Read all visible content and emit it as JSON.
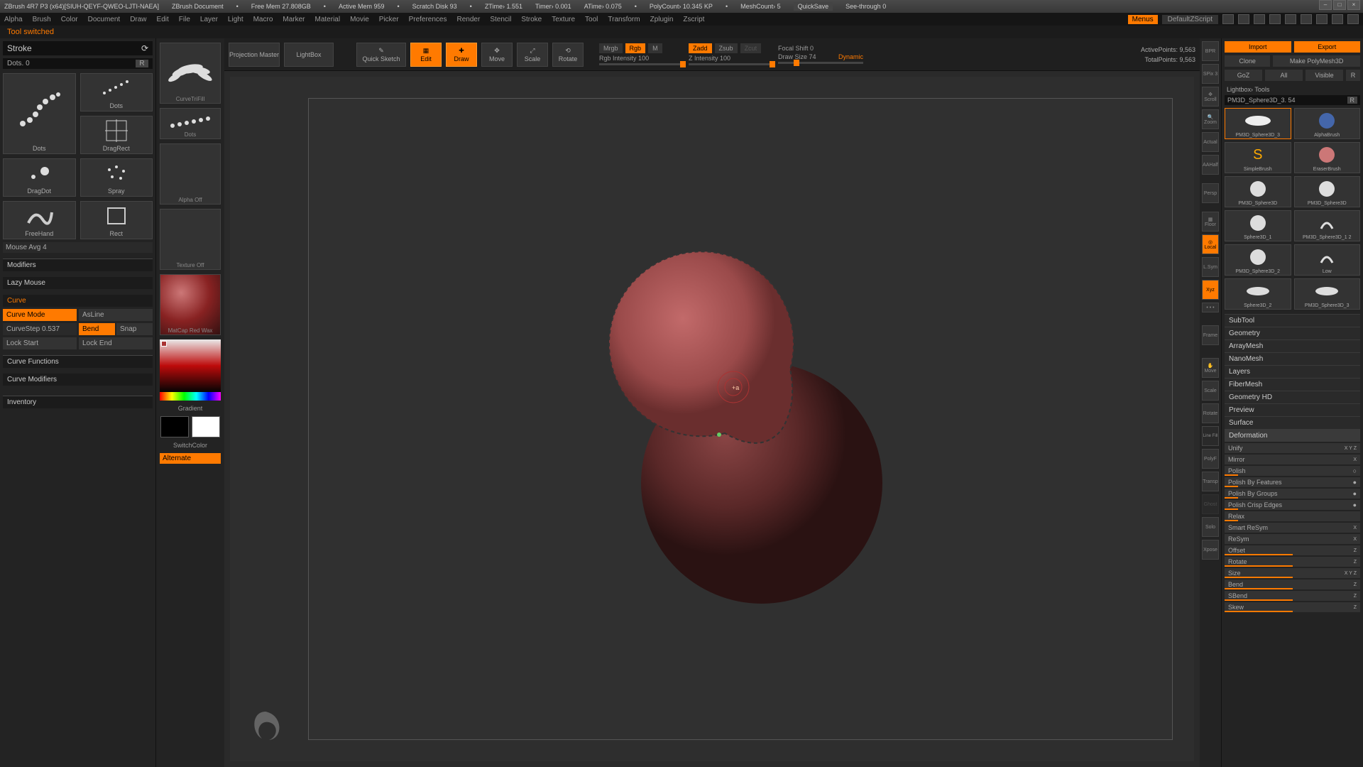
{
  "titlebar": {
    "app": "ZBrush 4R7 P3 (x64)[SIUH-QEYF-QWEO-LJTI-NAEA]",
    "doc": "ZBrush Document",
    "mem": "Free Mem 27.808GB",
    "actmem": "Active Mem 959",
    "scratch": "Scratch Disk 93",
    "ztime": "ZTime› 1.551",
    "timer": "Timer› 0.001",
    "atime": "ATime› 0.075",
    "poly": "PolyCount› 10.345 KP",
    "mesh": "MeshCount› 5",
    "quicksave": "QuickSave",
    "seethrough": "See-through 0"
  },
  "menubar": {
    "items": [
      "Alpha",
      "Brush",
      "Color",
      "Document",
      "Draw",
      "Edit",
      "File",
      "Layer",
      "Light",
      "Macro",
      "Marker",
      "Material",
      "Movie",
      "Picker",
      "Preferences",
      "Render",
      "Stencil",
      "Stroke",
      "Texture",
      "Tool",
      "Transform",
      "Zplugin",
      "Zscript"
    ],
    "menus": "Menus",
    "script": "DefaultZScript"
  },
  "status": "Tool switched",
  "stroke": {
    "title": "Stroke",
    "dots_label": "Dots. 0",
    "r": "R",
    "cells": [
      "",
      "Dots",
      "DragRect",
      "DragDot",
      "Spray",
      "FreeHand",
      "Rect"
    ],
    "mouse_avg": "Mouse Avg 4",
    "sections": {
      "modifiers": "Modifiers",
      "lazy": "Lazy Mouse",
      "curve": "Curve",
      "curvefn": "Curve Functions",
      "curvemod": "Curve Modifiers",
      "inventory": "Inventory"
    },
    "curveopts": {
      "mode": "Curve Mode",
      "asline": "AsLine",
      "step": "CurveStep 0.537",
      "bend": "Bend",
      "snap": "Snap",
      "lockstart": "Lock Start",
      "lockend": "Lock End"
    }
  },
  "col2": {
    "brush": "CurveTriFill",
    "dots": "Dots",
    "alpha": "Alpha Off",
    "texture": "Texture Off",
    "material": "MatCap Red Wax",
    "gradient": "Gradient",
    "switch": "SwitchColor",
    "alternate": "Alternate"
  },
  "toolbar": {
    "projection": "Projection Master",
    "lightbox": "LightBox",
    "quick": "Quick Sketch",
    "edit": "Edit",
    "draw": "Draw",
    "move": "Move",
    "scale": "Scale",
    "rotate": "Rotate",
    "mrgb": "Mrgb",
    "rgb": "Rgb",
    "m": "M",
    "rgb_int": "Rgb Intensity 100",
    "zadd": "Zadd",
    "zsub": "Zsub",
    "zcut": "Zcut",
    "z_int": "Z Intensity 100",
    "focal": "Focal Shift 0",
    "draw_size": "Draw Size 74",
    "dynamic": "Dynamic",
    "active_pts": "ActivePoints: 9,563",
    "total_pts": "TotalPoints: 9,563"
  },
  "rdock": [
    "BPR",
    "SPix 3",
    "Scroll",
    "Zoom",
    "Actual",
    "AAHalf",
    "Persp",
    "Floor",
    "Local",
    "L.Sym",
    "Xyz",
    "PolyF",
    "Transp",
    "Ghost",
    "Solo",
    "Xpose"
  ],
  "tool": {
    "load": "Import",
    "save": "Export",
    "copy": "Clone",
    "paste": "Make PolyMesh3D",
    "goz": "GoZ",
    "all": "All",
    "visible": "Visible",
    "r": "R",
    "lightbox": "Lightbox› Tools",
    "name": "PM3D_Sphere3D_3. 54",
    "items": [
      "PM3D_Sphere3D_3",
      "AlphaBrush",
      "SimpleBrush",
      "EraserBrush",
      "PM3D_Sphere3D",
      "PM3D_Sphere3D",
      "Sphere3D_1",
      "PM3D_Sphere3D_1 2",
      "PM3D_Sphere3D_2",
      "Low",
      "Sphere3D_2",
      "PM3D_Sphere3D_3"
    ],
    "accordions": [
      "SubTool",
      "Geometry",
      "ArrayMesh",
      "NanoMesh",
      "Layers",
      "FiberMesh",
      "Geometry HD",
      "Preview",
      "Surface"
    ],
    "deformation": "Deformation",
    "deforms": [
      "Unify",
      "Mirror",
      "Polish",
      "Polish By Features",
      "Polish By Groups",
      "Polish Crisp Edges",
      "Relax",
      "Smart ReSym",
      "ReSym",
      "Offset",
      "Rotate",
      "Size",
      "Bend",
      "SBend",
      "Skew"
    ]
  }
}
